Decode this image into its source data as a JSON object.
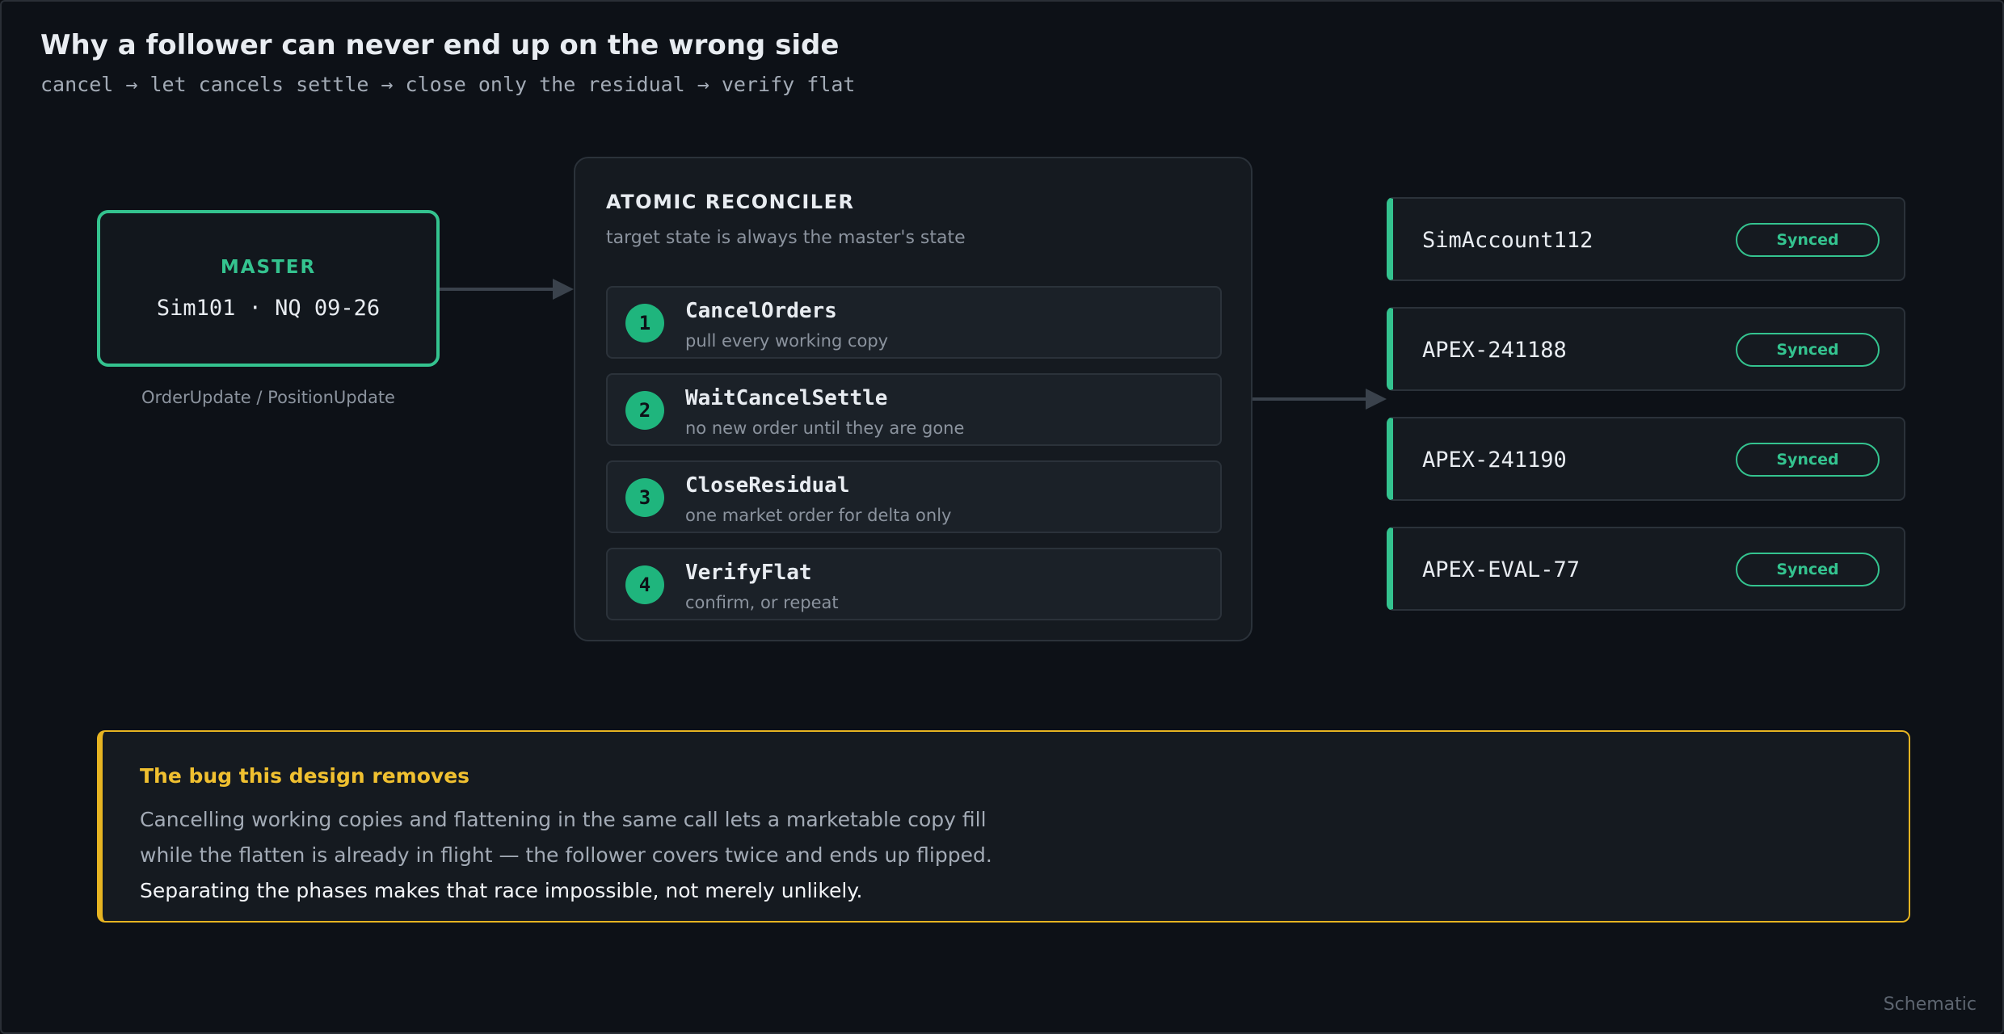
{
  "header": {
    "title": "Why a follower can never end up on the wrong side",
    "subtitle": "cancel → let cancels settle → close only the residual → verify flat"
  },
  "master": {
    "label": "MASTER",
    "account": "Sim101 · NQ 09-26",
    "caption": "OrderUpdate / PositionUpdate"
  },
  "reconciler": {
    "title": "ATOMIC RECONCILER",
    "subtitle": "target state is always the master's state",
    "steps": [
      {
        "num": "1",
        "name": "CancelOrders",
        "desc": "pull every working copy"
      },
      {
        "num": "2",
        "name": "WaitCancelSettle",
        "desc": "no new order until they are gone"
      },
      {
        "num": "3",
        "name": "CloseResidual",
        "desc": "one market order for delta only"
      },
      {
        "num": "4",
        "name": "VerifyFlat",
        "desc": "confirm, or repeat"
      }
    ]
  },
  "followers": [
    {
      "name": "SimAccount112",
      "status": "Synced"
    },
    {
      "name": "APEX-241188",
      "status": "Synced"
    },
    {
      "name": "APEX-241190",
      "status": "Synced"
    },
    {
      "name": "APEX-EVAL-77",
      "status": "Synced"
    }
  ],
  "callout": {
    "title": "The bug this design removes",
    "line1": "Cancelling working copies and flattening in the same call lets a marketable copy fill",
    "line2": "while the flatten is already in flight — the follower covers twice and ends up flipped.",
    "line3": "Separating the phases makes that race impossible, not merely unlikely."
  },
  "footer": {
    "label": "Schematic"
  },
  "colors": {
    "accent": "#34c38f",
    "warning": "#e6b422",
    "background": "#0d1117"
  }
}
